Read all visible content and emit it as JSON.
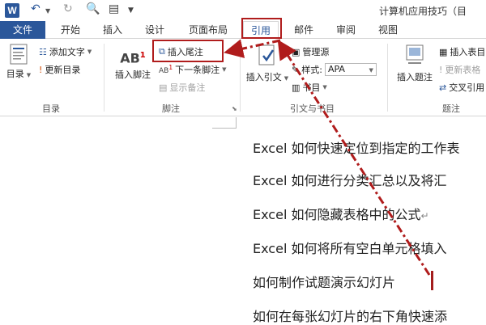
{
  "titlebar": {
    "app_logo": "W",
    "title": "计算机应用技巧（目"
  },
  "tabs": [
    {
      "label": "文件"
    },
    {
      "label": "开始"
    },
    {
      "label": "插入"
    },
    {
      "label": "设计"
    },
    {
      "label": "页面布局"
    },
    {
      "label": "引用"
    },
    {
      "label": "邮件"
    },
    {
      "label": "审阅"
    },
    {
      "label": "视图"
    }
  ],
  "ribbon": {
    "toc": {
      "big_label": "目录",
      "add_text": "添加文字",
      "update_toc": "更新目录",
      "group": "目录"
    },
    "footnotes": {
      "insert_footnote": "插入脚注",
      "insert_endnote": "插入尾注",
      "next_footnote": "下一条脚注",
      "show_notes": "显示备注",
      "group": "脚注"
    },
    "citations": {
      "insert_citation": "插入引文",
      "manage_sources": "管理源",
      "style_label": "样式:",
      "style_value": "APA",
      "bibliography": "书目",
      "group": "引文与书目"
    },
    "captions": {
      "insert_caption": "插入题注",
      "insert_table_of_figures": "插入表目",
      "update_table": "更新表格",
      "cross_reference": "交叉引用",
      "group": "题注"
    }
  },
  "document": {
    "lines": [
      "Excel 如何快速定位到指定的工作表",
      "Excel 如何进行分类汇总以及将汇",
      "Excel 如何隐藏表格中的公式",
      "Excel 如何将所有空白单元格填入",
      "如何制作试题演示幻灯片",
      "如何在每张幻灯片的右下角快速添"
    ],
    "pilcrow": "↵"
  },
  "colors": {
    "accent": "#2b579a",
    "annotation": "#b01c1c"
  }
}
